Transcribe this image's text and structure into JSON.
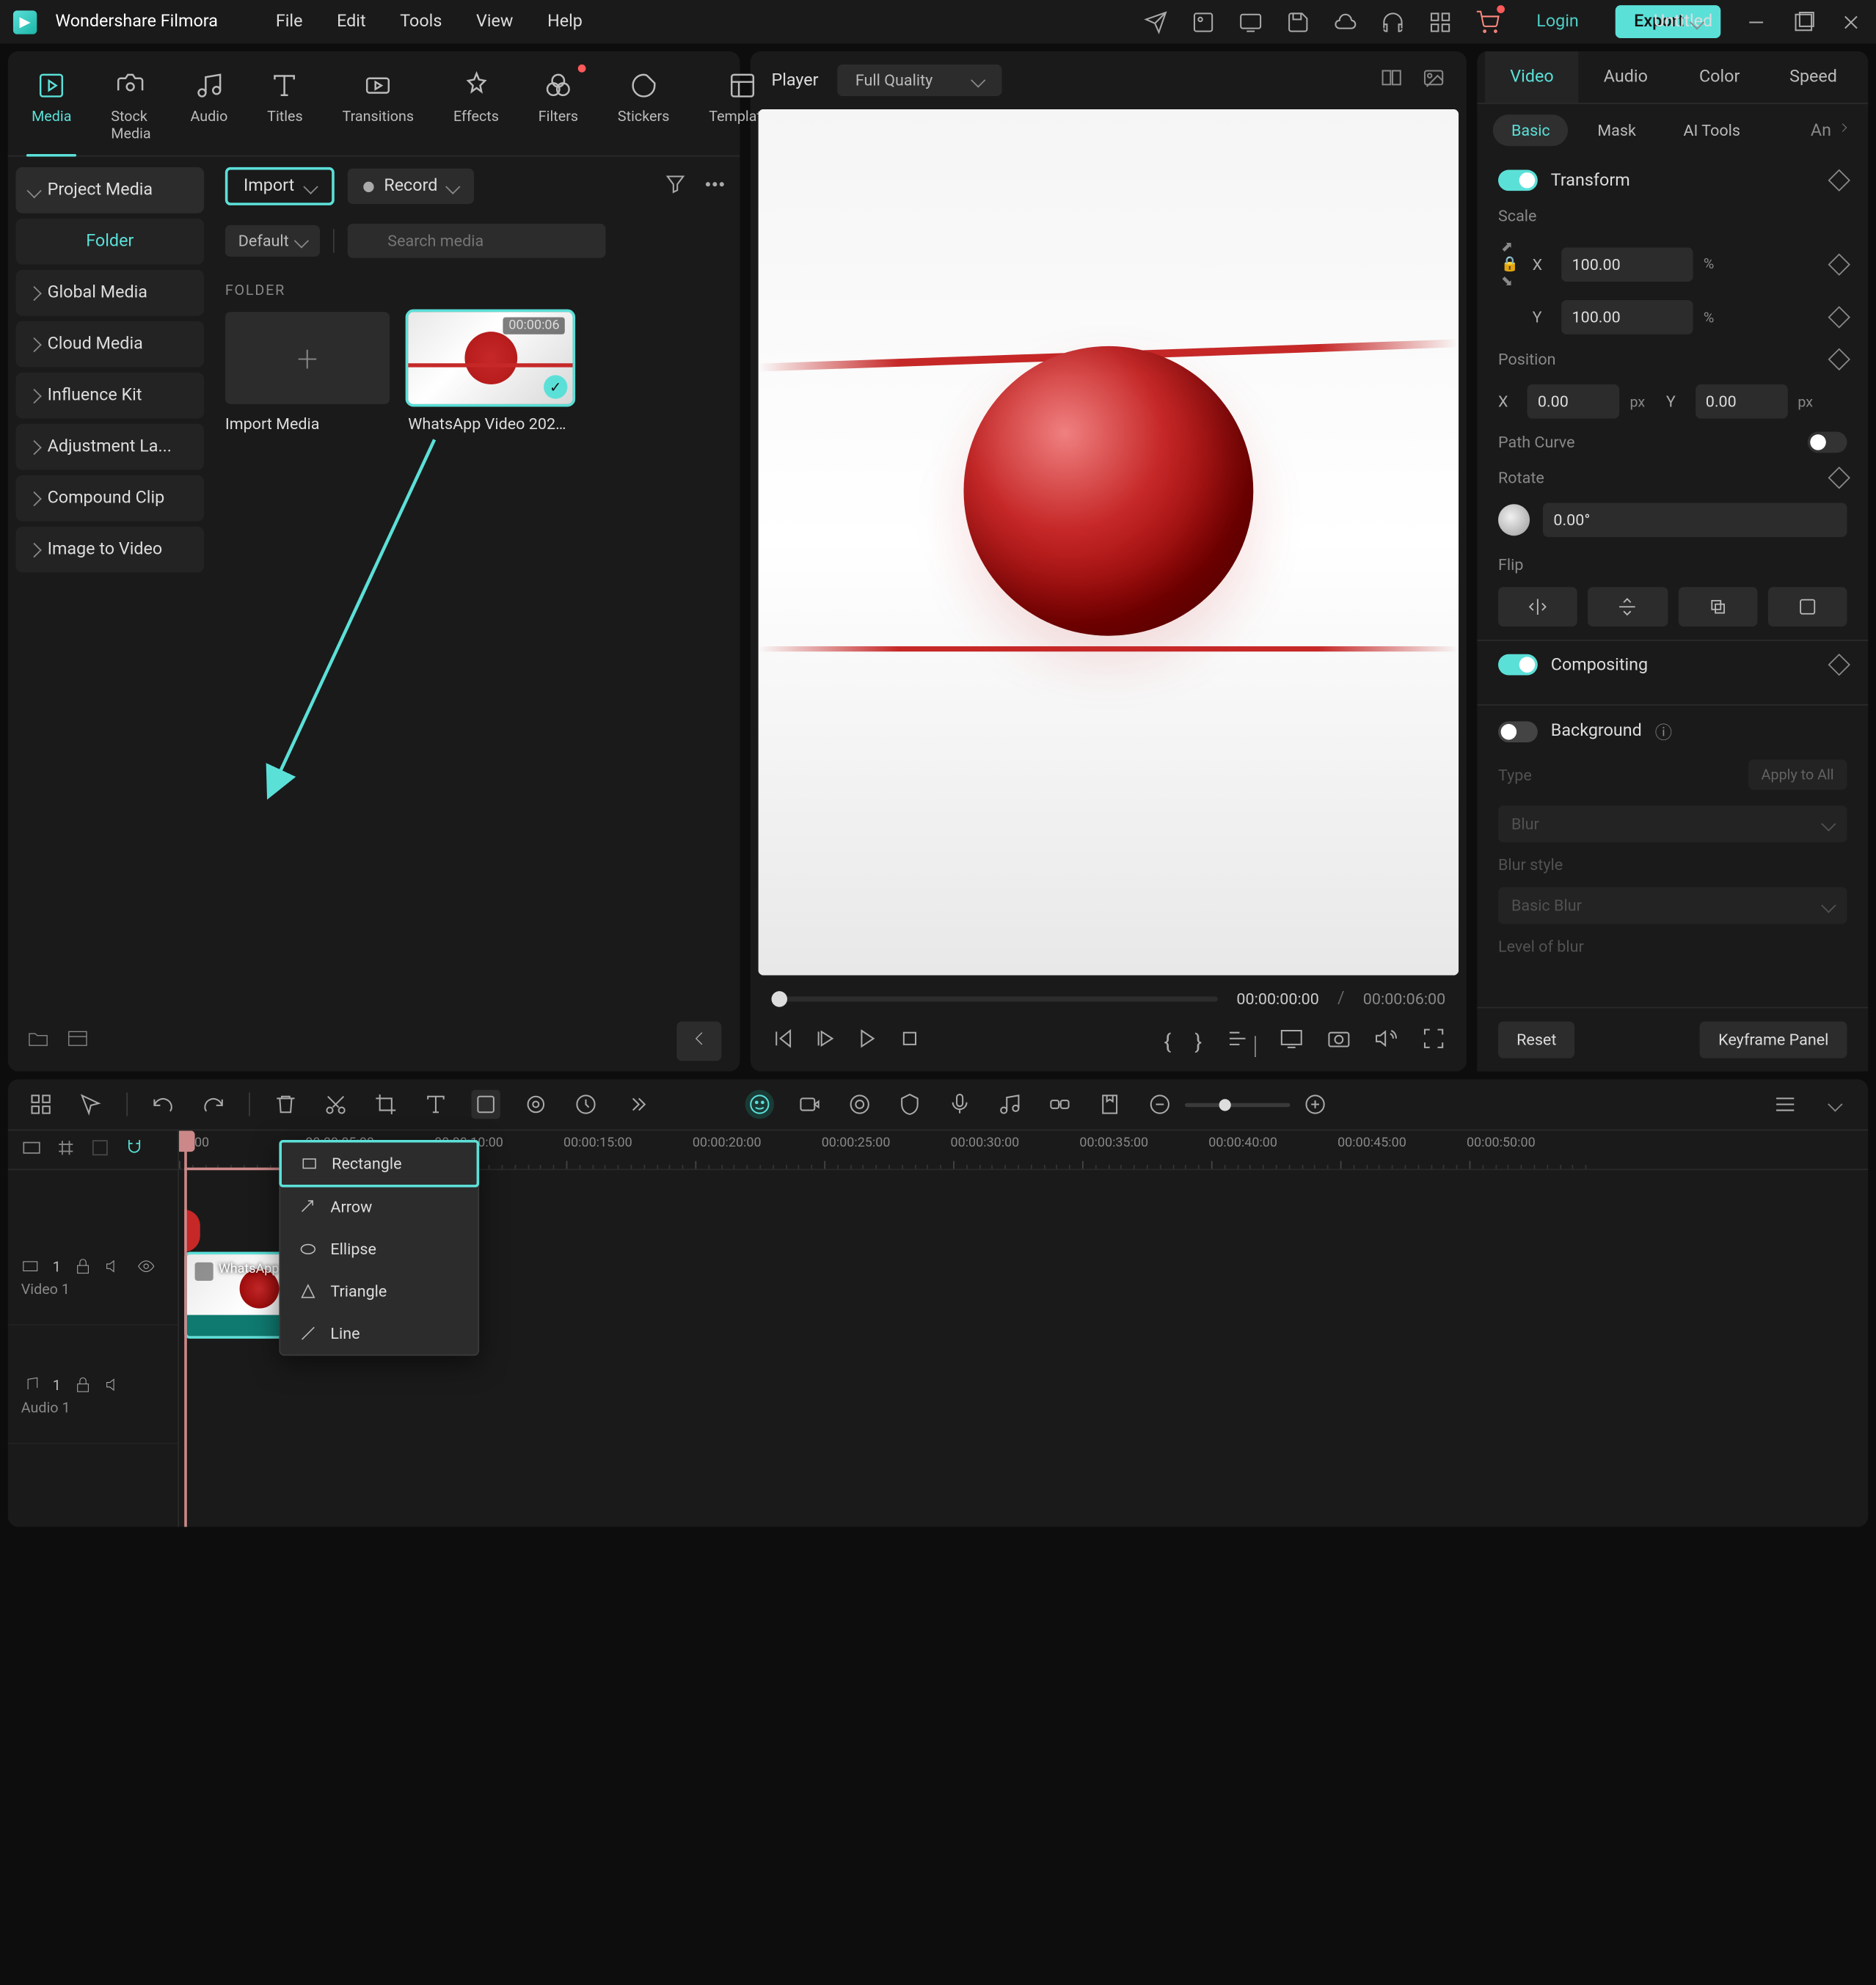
{
  "app": {
    "name": "Wondershare Filmora",
    "doc_title": "Untitled"
  },
  "menu": [
    "File",
    "Edit",
    "Tools",
    "View",
    "Help"
  ],
  "titlebar": {
    "login": "Login",
    "export": "Export"
  },
  "top_tabs": [
    {
      "id": "media",
      "label": "Media"
    },
    {
      "id": "stock",
      "label": "Stock Media"
    },
    {
      "id": "audio",
      "label": "Audio"
    },
    {
      "id": "titles",
      "label": "Titles"
    },
    {
      "id": "transitions",
      "label": "Transitions"
    },
    {
      "id": "effects",
      "label": "Effects"
    },
    {
      "id": "filters",
      "label": "Filters",
      "badge": true
    },
    {
      "id": "stickers",
      "label": "Stickers"
    },
    {
      "id": "templates",
      "label": "Templates"
    }
  ],
  "sidebar": {
    "header": "Project Media",
    "sub": "Folder",
    "items": [
      "Global Media",
      "Cloud Media",
      "Influence Kit",
      "Adjustment La...",
      "Compound Clip",
      "Image to Video"
    ]
  },
  "media_tools": {
    "import": "Import",
    "record": "Record",
    "sort": "Default",
    "search_placeholder": "Search media"
  },
  "folder_label": "FOLDER",
  "media_items": [
    {
      "name": "Import Media",
      "type": "add"
    },
    {
      "name": "WhatsApp Video 2024...",
      "duration": "00:00:06",
      "selected": true
    }
  ],
  "player": {
    "label": "Player",
    "quality": "Full Quality",
    "current": "00:00:00:00",
    "total": "00:00:06:00"
  },
  "props": {
    "tabs": [
      "Video",
      "Audio",
      "Color",
      "Speed"
    ],
    "subtabs": [
      "Basic",
      "Mask",
      "AI Tools",
      "An"
    ],
    "transform": {
      "title": "Transform",
      "scale_label": "Scale",
      "x": "100.00",
      "y": "100.00",
      "percent": "%",
      "position_label": "Position",
      "pos_x": "0.00",
      "pos_y": "0.00",
      "px": "px",
      "path_curve": "Path Curve",
      "rotate_label": "Rotate",
      "rotate": "0.00°",
      "flip_label": "Flip"
    },
    "compositing": {
      "title": "Compositing"
    },
    "background": {
      "title": "Background",
      "type_label": "Type",
      "apply_all": "Apply to All",
      "type": "Blur",
      "style_label": "Blur style",
      "style": "Basic Blur",
      "level_label": "Level of blur"
    },
    "footer": {
      "reset": "Reset",
      "keyframe": "Keyframe Panel"
    }
  },
  "shape_menu": [
    "Rectangle",
    "Arrow",
    "Ellipse",
    "Triangle",
    "Line"
  ],
  "timeline": {
    "marks": [
      "00:00",
      "00:00:05:00",
      "00:00:10:00",
      "00:00:15:00",
      "00:00:20:00",
      "00:00:25:00",
      "00:00:30:00",
      "00:00:35:00",
      "00:00:40:00",
      "00:00:45:00",
      "00:00:50:00"
    ],
    "tracks": {
      "video1": "Video 1",
      "audio1": "Audio 1",
      "clip_label": "WhatsApp Vide..."
    }
  },
  "axis": {
    "x": "X",
    "y": "Y"
  }
}
